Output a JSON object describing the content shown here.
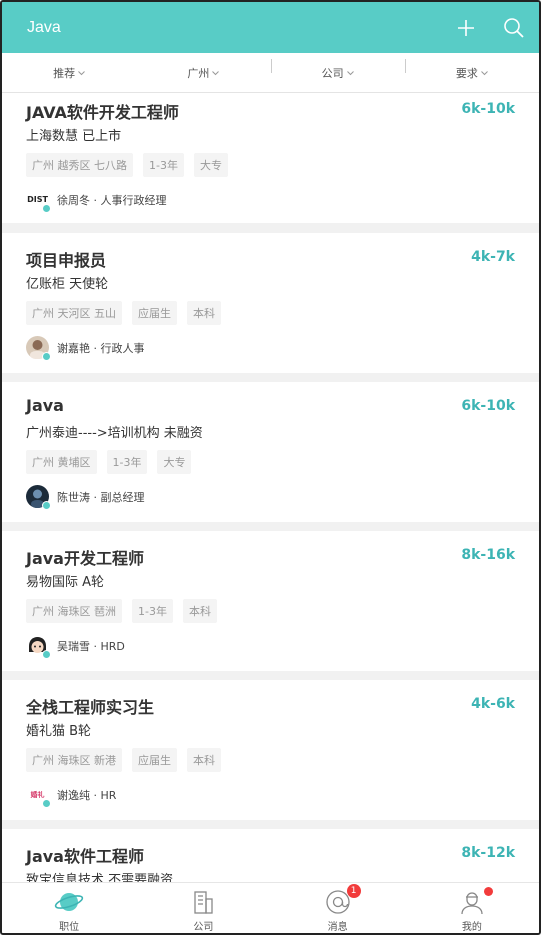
{
  "header": {
    "title": "Java"
  },
  "filters": [
    "推荐",
    "广州",
    "公司",
    "要求"
  ],
  "jobs": [
    {
      "title": "JAVA软件开发工程师",
      "salary": "6k-10k",
      "company": "上海数慧 已上市",
      "tags": [
        "广州 越秀区 七八路",
        "1-3年",
        "大专"
      ],
      "recruiter": "徐周冬 · 人事行政经理",
      "avatar_text": "DIST"
    },
    {
      "title": "项目申报员",
      "salary": "4k-7k",
      "company": "亿账柜 天使轮",
      "tags": [
        "广州 天河区 五山",
        "应届生",
        "本科"
      ],
      "recruiter": "谢嘉艳 · 行政人事",
      "avatar_text": ""
    },
    {
      "title": "Java",
      "salary": "6k-10k",
      "company": "广州泰迪---->培训机构 未融资",
      "tags": [
        "广州 黄埔区",
        "1-3年",
        "大专"
      ],
      "recruiter": "陈世涛 · 副总经理",
      "avatar_text": ""
    },
    {
      "title": "Java开发工程师",
      "salary": "8k-16k",
      "company": "易物国际 A轮",
      "tags": [
        "广州 海珠区 琶洲",
        "1-3年",
        "本科"
      ],
      "recruiter": "吴瑞雪 · HRD",
      "avatar_text": ""
    },
    {
      "title": "全栈工程师实习生",
      "salary": "4k-6k",
      "company": "婚礼猫 B轮",
      "tags": [
        "广州 海珠区 新港",
        "应届生",
        "本科"
      ],
      "recruiter": "谢逸纯 · HR",
      "avatar_text": "婚礼"
    },
    {
      "title": "Java软件工程师",
      "salary": "8k-12k",
      "company": "致宝信息技术 不需要融资",
      "tags": [],
      "recruiter": "",
      "avatar_text": ""
    }
  ],
  "nav": [
    {
      "label": "职位",
      "icon": "planet-icon",
      "active": true
    },
    {
      "label": "公司",
      "icon": "building-icon"
    },
    {
      "label": "消息",
      "icon": "message-icon",
      "badge": "1"
    },
    {
      "label": "我的",
      "icon": "profile-icon",
      "dot": true
    }
  ],
  "colors": {
    "accent": "#58ccc6",
    "salary": "#3db4b4",
    "badge": "#f23b3b"
  }
}
